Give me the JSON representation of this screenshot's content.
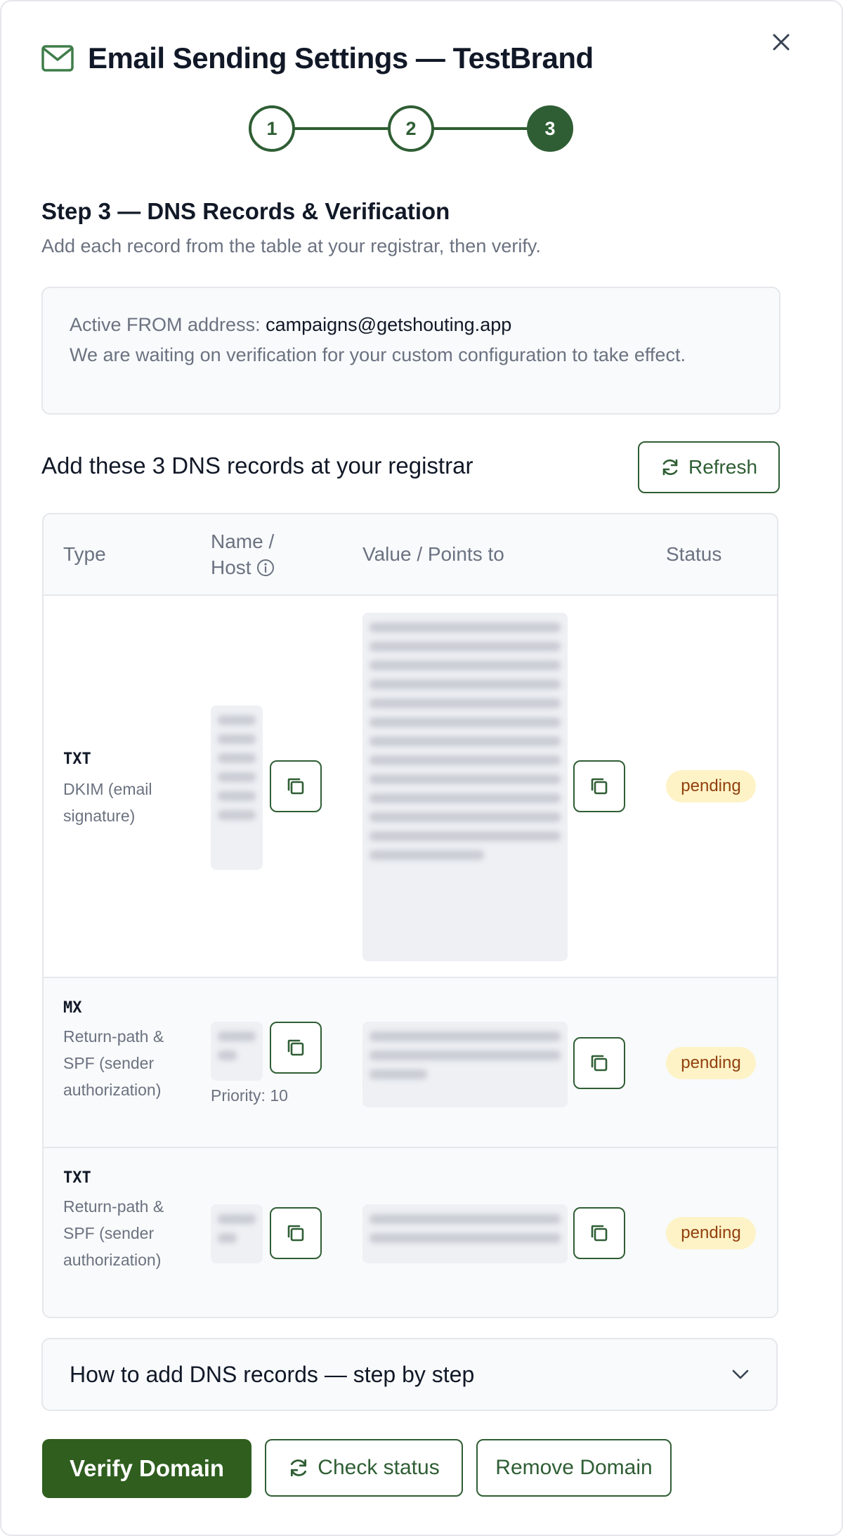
{
  "header": {
    "title": "Email Sending Settings — TestBrand"
  },
  "stepper": {
    "steps": [
      "1",
      "2",
      "3"
    ],
    "active_step": 3
  },
  "step": {
    "title": "Step 3 — DNS Records & Verification",
    "subtitle": "Add each record from the table at your registrar, then verify."
  },
  "info": {
    "label": "Active FROM address:",
    "address": "campaigns@getshouting.app",
    "message": "We are waiting on verification for your custom configuration to take effect."
  },
  "records": {
    "title": "Add these 3 DNS records at your registrar",
    "refresh_label": "Refresh",
    "columns": {
      "type": "Type",
      "name": "Name / Host",
      "value": "Value / Points to",
      "status": "Status"
    },
    "rows": [
      {
        "type": "TXT",
        "description": "DKIM (email signature)",
        "status": "pending"
      },
      {
        "type": "MX",
        "description": "Return-path & SPF (sender authorization)",
        "priority": "Priority: 10",
        "status": "pending"
      },
      {
        "type": "TXT",
        "description": "Return-path & SPF (sender authorization)",
        "status": "pending"
      }
    ]
  },
  "accordion": {
    "label": "How to add DNS records — step by step"
  },
  "actions": {
    "verify_label": "Verify Domain",
    "check_label": "Check status",
    "remove_label": "Remove Domain"
  },
  "colors": {
    "brand_green": "#2f5e34",
    "primary_button": "#2f5e1f",
    "pending_bg": "#fdf3c7",
    "pending_text": "#92400e"
  },
  "icons": [
    "mail-icon",
    "close-icon",
    "refresh-icon",
    "info-icon",
    "copy-icon",
    "chevron-down-icon"
  ]
}
